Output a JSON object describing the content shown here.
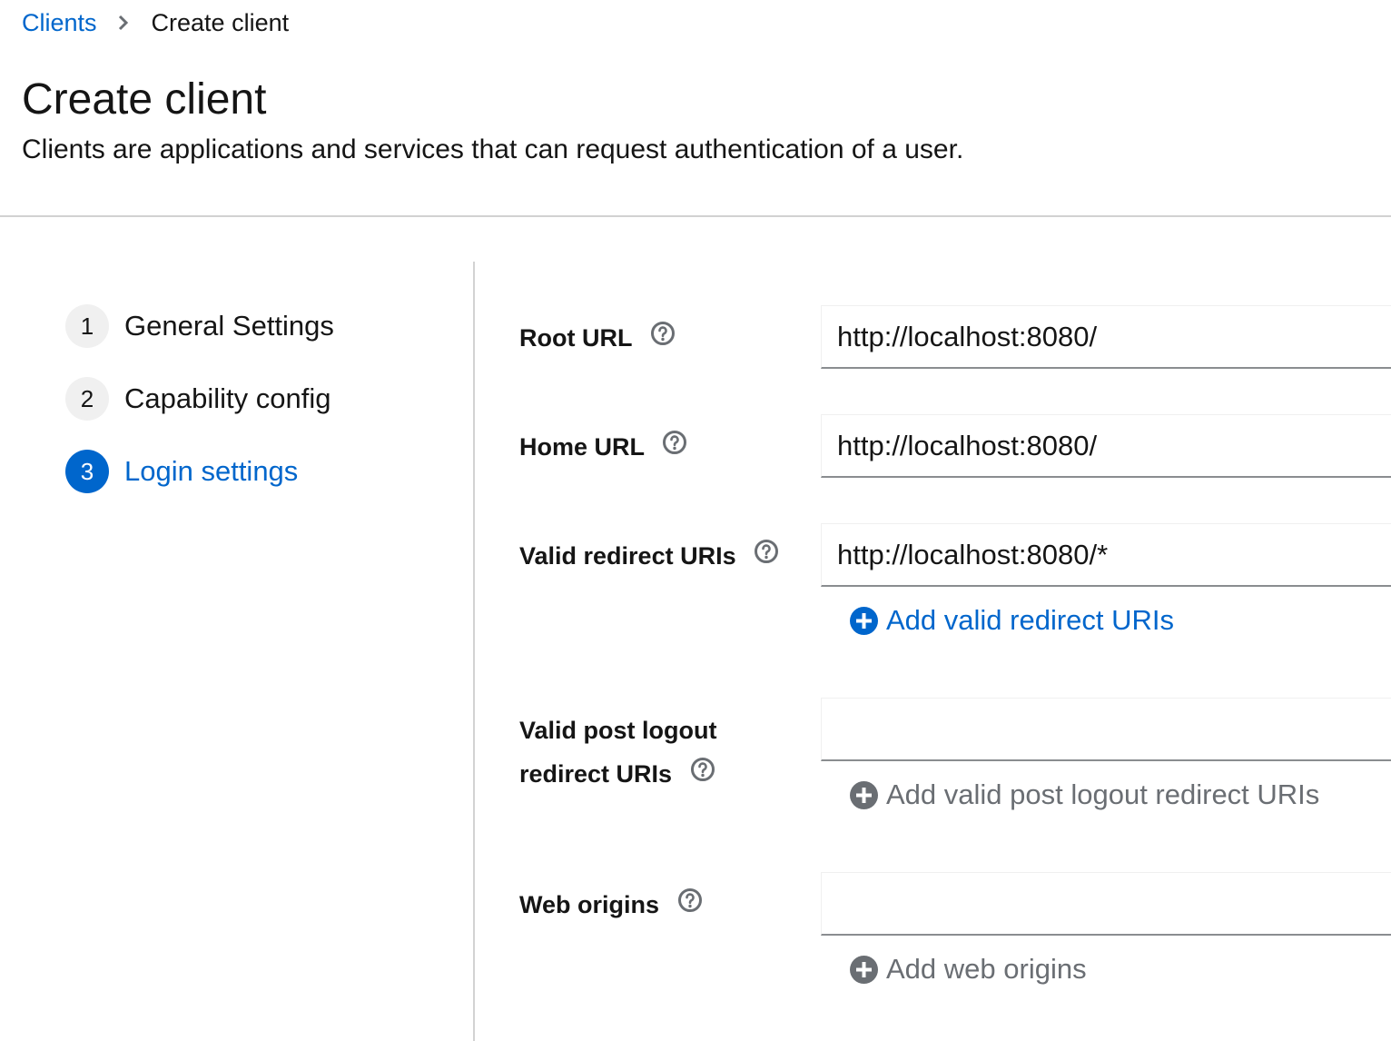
{
  "breadcrumb": {
    "parent": "Clients",
    "current": "Create client"
  },
  "header": {
    "title": "Create client",
    "description": "Clients are applications and services that can request authentication of a user."
  },
  "wizard": {
    "steps": [
      {
        "number": "1",
        "label": "General Settings",
        "current": false
      },
      {
        "number": "2",
        "label": "Capability config",
        "current": false
      },
      {
        "number": "3",
        "label": "Login settings",
        "current": true
      }
    ]
  },
  "form": {
    "root_url": {
      "label": "Root URL",
      "value": "http://localhost:8080/"
    },
    "home_url": {
      "label": "Home URL",
      "value": "http://localhost:8080/"
    },
    "valid_redirect_uris": {
      "label": "Valid redirect URIs",
      "value": "http://localhost:8080/*",
      "add_label": "Add valid redirect URIs"
    },
    "valid_post_logout": {
      "label_line1": "Valid post logout",
      "label_line2": "redirect URIs",
      "value": "",
      "add_label": "Add valid post logout redirect URIs"
    },
    "web_origins": {
      "label": "Web origins",
      "value": "",
      "add_label": "Add web origins"
    }
  },
  "icons": {
    "help": "question-circle-icon",
    "add": "plus-circle-icon",
    "separator": "chevron-right-icon"
  },
  "colors": {
    "link": "#0066cc",
    "text": "#151515",
    "muted": "#6a6e73",
    "divider": "#d2d2d2"
  }
}
